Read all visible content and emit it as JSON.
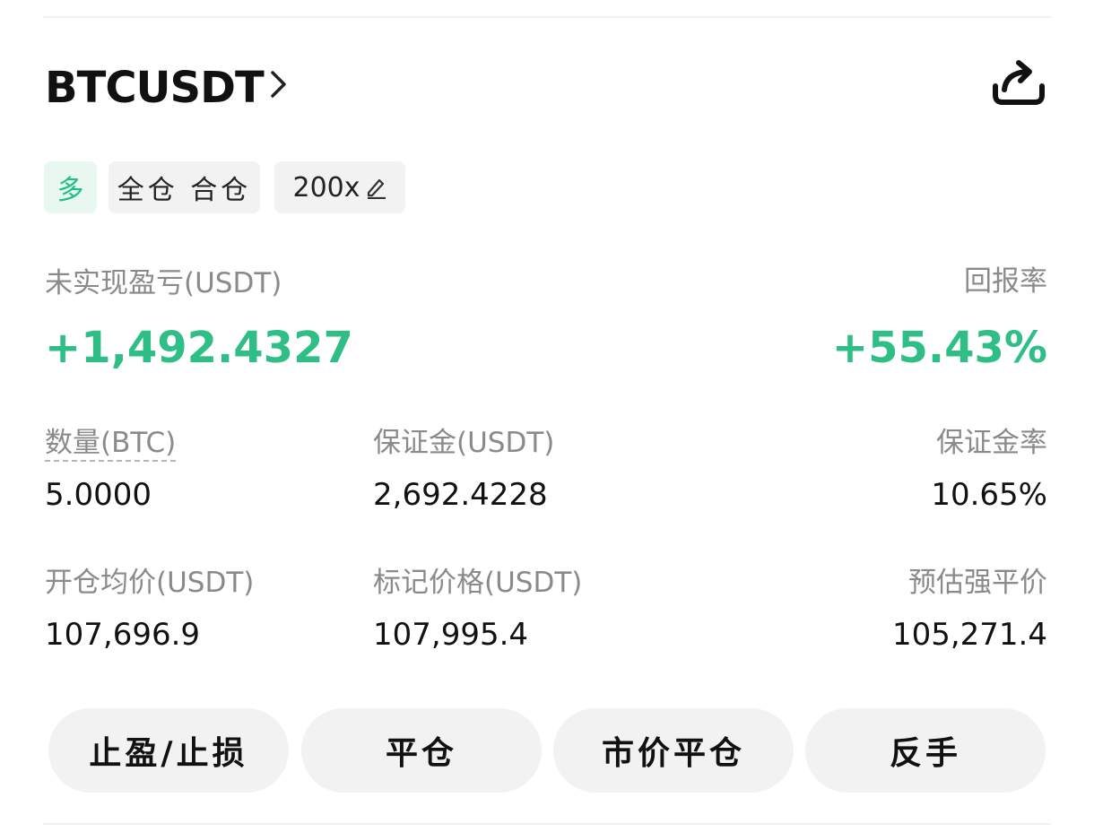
{
  "position": {
    "symbol": "BTCUSDT",
    "side": "多",
    "margin_mode": "全仓 合仓",
    "leverage": "200x"
  },
  "pnl": {
    "unrealized_label": "未实现盈亏(USDT)",
    "unrealized_value": "+1,492.4327",
    "roe_label": "回报率",
    "roe_value": "+55.43%"
  },
  "stats": {
    "qty_label": "数量(BTC)",
    "qty_value": "5.0000",
    "margin_label": "保证金(USDT)",
    "margin_value": "2,692.4228",
    "margin_ratio_label": "保证金率",
    "margin_ratio_value": "10.65%",
    "entry_label": "开仓均价(USDT)",
    "entry_value": "107,696.9",
    "mark_label": "标记价格(USDT)",
    "mark_value": "107,995.4",
    "liq_label": "预估强平价",
    "liq_value": "105,271.4"
  },
  "actions": {
    "tp_sl": "止盈/止损",
    "close": "平仓",
    "market_close": "市价平仓",
    "reverse": "反手"
  },
  "colors": {
    "profit": "#2fbf86",
    "long_tag_bg": "#e8f7f0",
    "button_bg": "#f2f2f2"
  },
  "icons": {
    "symbol_chevron": "chevron-right-icon",
    "share": "share-icon",
    "edit_leverage": "pencil-icon"
  }
}
